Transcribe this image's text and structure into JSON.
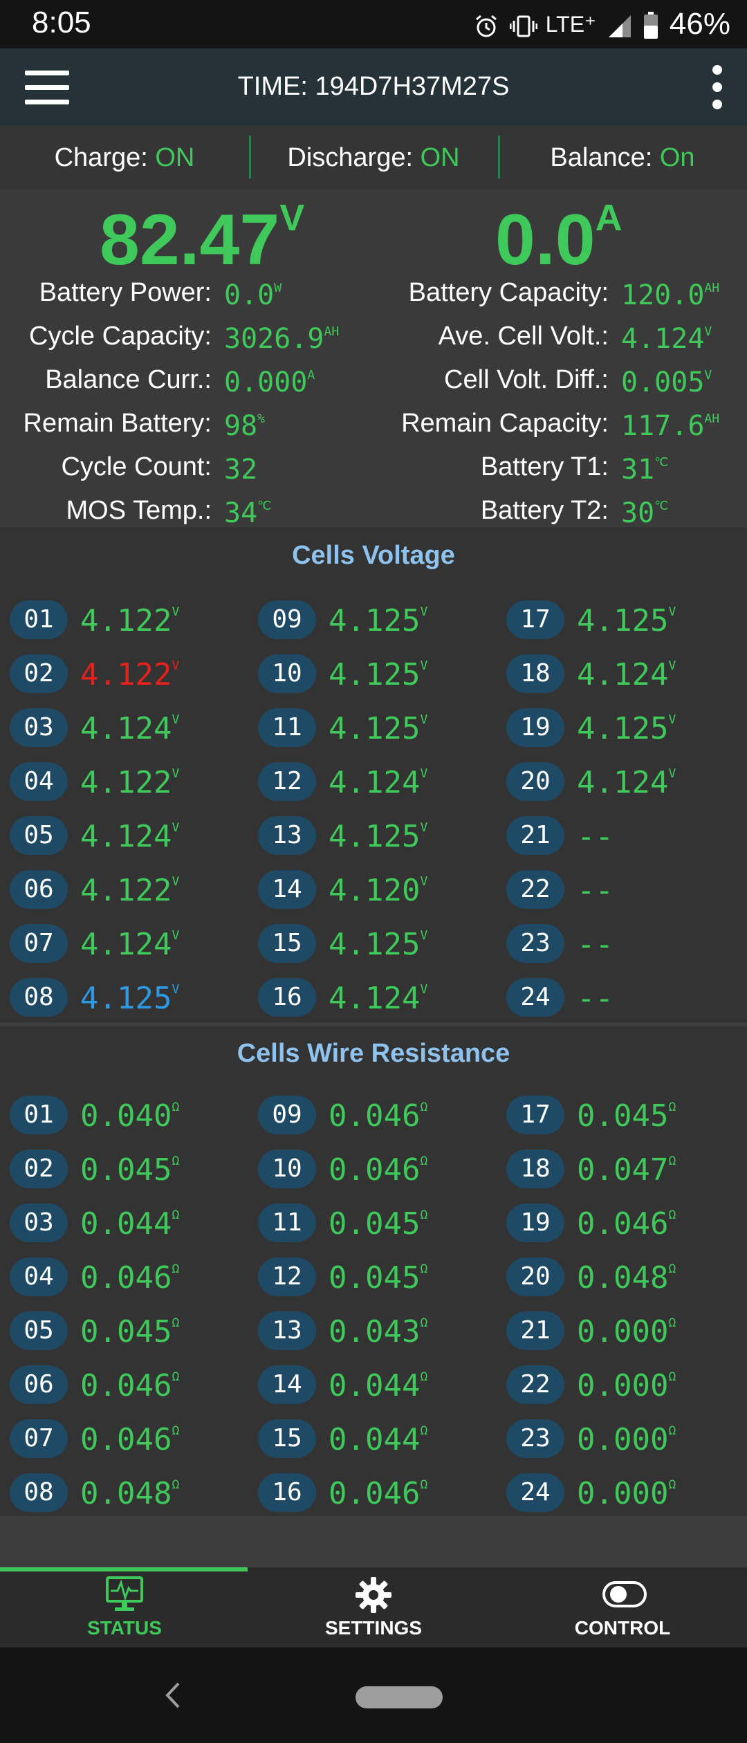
{
  "status_bar": {
    "time": "8:05",
    "network": "LTE⁺",
    "battery": "46%"
  },
  "app_bar": {
    "title": "TIME: 194D7H37M27S"
  },
  "switches": [
    {
      "label": "Charge:",
      "value": "ON"
    },
    {
      "label": "Discharge:",
      "value": "ON"
    },
    {
      "label": "Balance:",
      "value": "On"
    }
  ],
  "voltage": {
    "value": "82.47",
    "unit": "V"
  },
  "current": {
    "value": "0.0",
    "unit": "A"
  },
  "left_stats": [
    {
      "label": "Battery Power:",
      "value": "0.0",
      "unit": "W"
    },
    {
      "label": "Cycle Capacity:",
      "value": "3026.9",
      "unit": "AH"
    },
    {
      "label": "Balance Curr.:",
      "value": "0.000",
      "unit": "A"
    },
    {
      "label": "Remain Battery:",
      "value": "98",
      "unit": "%"
    },
    {
      "label": "Cycle Count:",
      "value": "32",
      "unit": ""
    },
    {
      "label": "MOS Temp.:",
      "value": "34",
      "unit": "℃"
    }
  ],
  "right_stats": [
    {
      "label": "Battery Capacity:",
      "value": "120.0",
      "unit": "AH"
    },
    {
      "label": "Ave. Cell Volt.:",
      "value": "4.124",
      "unit": "V"
    },
    {
      "label": "Cell Volt. Diff.:",
      "value": "0.005",
      "unit": "V"
    },
    {
      "label": "Remain Capacity:",
      "value": "117.6",
      "unit": "AH"
    },
    {
      "label": "Battery T1:",
      "value": "31",
      "unit": "℃"
    },
    {
      "label": "Battery T2:",
      "value": "30",
      "unit": "℃"
    }
  ],
  "cells_voltage": {
    "title": "Cells Voltage",
    "cells": [
      {
        "id": "01",
        "value": "4.122",
        "unit": "V",
        "color": "#3ec95a"
      },
      {
        "id": "02",
        "value": "4.122",
        "unit": "V",
        "color": "#e8201c"
      },
      {
        "id": "03",
        "value": "4.124",
        "unit": "V",
        "color": "#3ec95a"
      },
      {
        "id": "04",
        "value": "4.122",
        "unit": "V",
        "color": "#3ec95a"
      },
      {
        "id": "05",
        "value": "4.124",
        "unit": "V",
        "color": "#3ec95a"
      },
      {
        "id": "06",
        "value": "4.122",
        "unit": "V",
        "color": "#3ec95a"
      },
      {
        "id": "07",
        "value": "4.124",
        "unit": "V",
        "color": "#3ec95a"
      },
      {
        "id": "08",
        "value": "4.125",
        "unit": "V",
        "color": "#2e9ae6"
      },
      {
        "id": "09",
        "value": "4.125",
        "unit": "V",
        "color": "#3ec95a"
      },
      {
        "id": "10",
        "value": "4.125",
        "unit": "V",
        "color": "#3ec95a"
      },
      {
        "id": "11",
        "value": "4.125",
        "unit": "V",
        "color": "#3ec95a"
      },
      {
        "id": "12",
        "value": "4.124",
        "unit": "V",
        "color": "#3ec95a"
      },
      {
        "id": "13",
        "value": "4.125",
        "unit": "V",
        "color": "#3ec95a"
      },
      {
        "id": "14",
        "value": "4.120",
        "unit": "V",
        "color": "#3ec95a"
      },
      {
        "id": "15",
        "value": "4.125",
        "unit": "V",
        "color": "#3ec95a"
      },
      {
        "id": "16",
        "value": "4.124",
        "unit": "V",
        "color": "#3ec95a"
      },
      {
        "id": "17",
        "value": "4.125",
        "unit": "V",
        "color": "#3ec95a"
      },
      {
        "id": "18",
        "value": "4.124",
        "unit": "V",
        "color": "#3ec95a"
      },
      {
        "id": "19",
        "value": "4.125",
        "unit": "V",
        "color": "#3ec95a"
      },
      {
        "id": "20",
        "value": "4.124",
        "unit": "V",
        "color": "#3ec95a"
      },
      {
        "id": "21",
        "value": "--",
        "unit": "",
        "color": "#3ec95a"
      },
      {
        "id": "22",
        "value": "--",
        "unit": "",
        "color": "#3ec95a"
      },
      {
        "id": "23",
        "value": "--",
        "unit": "",
        "color": "#3ec95a"
      },
      {
        "id": "24",
        "value": "--",
        "unit": "",
        "color": "#3ec95a"
      }
    ]
  },
  "cells_resistance": {
    "title": "Cells Wire Resistance",
    "cells": [
      {
        "id": "01",
        "value": "0.040",
        "unit": "Ω"
      },
      {
        "id": "02",
        "value": "0.045",
        "unit": "Ω"
      },
      {
        "id": "03",
        "value": "0.044",
        "unit": "Ω"
      },
      {
        "id": "04",
        "value": "0.046",
        "unit": "Ω"
      },
      {
        "id": "05",
        "value": "0.045",
        "unit": "Ω"
      },
      {
        "id": "06",
        "value": "0.046",
        "unit": "Ω"
      },
      {
        "id": "07",
        "value": "0.046",
        "unit": "Ω"
      },
      {
        "id": "08",
        "value": "0.048",
        "unit": "Ω"
      },
      {
        "id": "09",
        "value": "0.046",
        "unit": "Ω"
      },
      {
        "id": "10",
        "value": "0.046",
        "unit": "Ω"
      },
      {
        "id": "11",
        "value": "0.045",
        "unit": "Ω"
      },
      {
        "id": "12",
        "value": "0.045",
        "unit": "Ω"
      },
      {
        "id": "13",
        "value": "0.043",
        "unit": "Ω"
      },
      {
        "id": "14",
        "value": "0.044",
        "unit": "Ω"
      },
      {
        "id": "15",
        "value": "0.044",
        "unit": "Ω"
      },
      {
        "id": "16",
        "value": "0.046",
        "unit": "Ω"
      },
      {
        "id": "17",
        "value": "0.045",
        "unit": "Ω"
      },
      {
        "id": "18",
        "value": "0.047",
        "unit": "Ω"
      },
      {
        "id": "19",
        "value": "0.046",
        "unit": "Ω"
      },
      {
        "id": "20",
        "value": "0.048",
        "unit": "Ω"
      },
      {
        "id": "21",
        "value": "0.000",
        "unit": "Ω"
      },
      {
        "id": "22",
        "value": "0.000",
        "unit": "Ω"
      },
      {
        "id": "23",
        "value": "0.000",
        "unit": "Ω"
      },
      {
        "id": "24",
        "value": "0.000",
        "unit": "Ω"
      }
    ]
  },
  "bottom_nav": {
    "items": [
      {
        "label": "STATUS",
        "icon": "monitor-pulse-icon",
        "active": true
      },
      {
        "label": "SETTINGS",
        "icon": "gear-icon",
        "active": false
      },
      {
        "label": "CONTROL",
        "icon": "toggle-icon",
        "active": false
      }
    ],
    "active_color": "#3ec95a"
  },
  "colors": {
    "accent": "#3ec95a",
    "badge": "#1e4a66",
    "section_title": "#8ec3f0"
  }
}
